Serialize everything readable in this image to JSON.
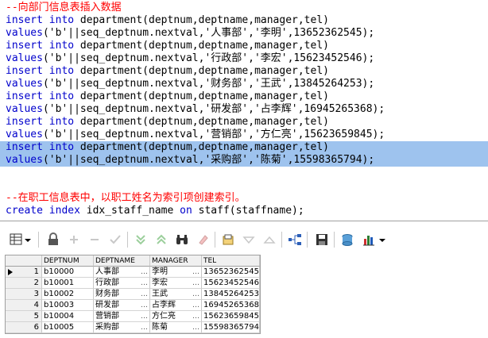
{
  "editor": {
    "comment1": "--向部门信息表插入数据",
    "statements": [
      {
        "kw": "insert into",
        "rest": " department(deptnum,deptname,manager,tel)",
        "values_kw": "values",
        "values_rest": "('b'||seq_deptnum.nextval,'人事部','李明',13652362545);"
      },
      {
        "kw": "insert into",
        "rest": " department(deptnum,deptname,manager,tel)",
        "values_kw": "values",
        "values_rest": "('b'||seq_deptnum.nextval,'行政部','李宏',15623452546);"
      },
      {
        "kw": "insert into",
        "rest": " department(deptnum,deptname,manager,tel)",
        "values_kw": "values",
        "values_rest": "('b'||seq_deptnum.nextval,'财务部','王武',13845264253);"
      },
      {
        "kw": "insert into",
        "rest": " department(deptnum,deptname,manager,tel)",
        "values_kw": "values",
        "values_rest": "('b'||seq_deptnum.nextval,'研发部','占李辉',16945265368);"
      },
      {
        "kw": "insert into",
        "rest": " department(deptnum,deptname,manager,tel)",
        "values_kw": "values",
        "values_rest": "('b'||seq_deptnum.nextval,'营销部','方仁亮',15623659845);"
      },
      {
        "kw": "insert into",
        "rest": " department(deptnum,deptname,manager,tel)",
        "values_kw": "values",
        "values_rest": "('b'||seq_deptnum.nextval,'采购部','陈菊',15598365794);"
      }
    ],
    "comment2": "--在职工信息表中，以职工姓名为索引项创建索引。",
    "create_kw1": "create index",
    "create_name": " idx_staff_name ",
    "create_kw2": "on",
    "create_rest": " staff(staffname);"
  },
  "toolbar": {
    "icons": [
      "grid-view-icon",
      "lock-icon",
      "add-icon",
      "remove-icon",
      "post-icon",
      "move-down-icon",
      "move-up-icon",
      "find-icon",
      "clear-icon",
      "export-icon",
      "filter-down-icon",
      "filter-up-icon",
      "structure-icon",
      "save-icon",
      "query-icon",
      "chart-icon"
    ]
  },
  "grid": {
    "columns": [
      "DEPTNUM",
      "DEPTNAME",
      "MANAGER",
      "TEL"
    ],
    "rows": [
      {
        "num": "1",
        "deptnum": "b10000",
        "deptname": "人事部",
        "manager": "李明",
        "tel": "13652362545"
      },
      {
        "num": "2",
        "deptnum": "b10001",
        "deptname": "行政部",
        "manager": "李宏",
        "tel": "15623452546"
      },
      {
        "num": "3",
        "deptnum": "b10002",
        "deptname": "财务部",
        "manager": "王武",
        "tel": "13845264253"
      },
      {
        "num": "4",
        "deptnum": "b10003",
        "deptname": "研发部",
        "manager": "占李辉",
        "tel": "16945265368"
      },
      {
        "num": "5",
        "deptnum": "b10004",
        "deptname": "营销部",
        "manager": "方仁亮",
        "tel": "15623659845"
      },
      {
        "num": "6",
        "deptnum": "b10005",
        "deptname": "采购部",
        "manager": "陈菊",
        "tel": "15598365794"
      }
    ],
    "ellipsis": "…"
  }
}
